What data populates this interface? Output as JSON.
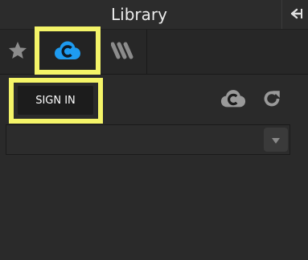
{
  "window": {
    "title": "Library",
    "collapse_icon": "arrow-left-to-bar-icon"
  },
  "tabs": [
    {
      "name": "favorites",
      "icon": "star-icon",
      "selected": false
    },
    {
      "name": "creative-cloud",
      "icon": "creative-cloud-icon",
      "selected": true,
      "accent": "#1e9bf0"
    },
    {
      "name": "w-library",
      "icon": "w-stripes-icon",
      "selected": false
    }
  ],
  "toolbar": {
    "sign_in_label": "SIGN IN",
    "cloud_status_icon": "creative-cloud-status-icon",
    "refresh_icon": "refresh-icon"
  },
  "library_select": {
    "value": "",
    "button_icon": "dropdown-arrow-icon"
  },
  "colors": {
    "background": "#2a2a2a",
    "highlight": "#f4f468",
    "cloud_accent": "#1e9bf0"
  }
}
